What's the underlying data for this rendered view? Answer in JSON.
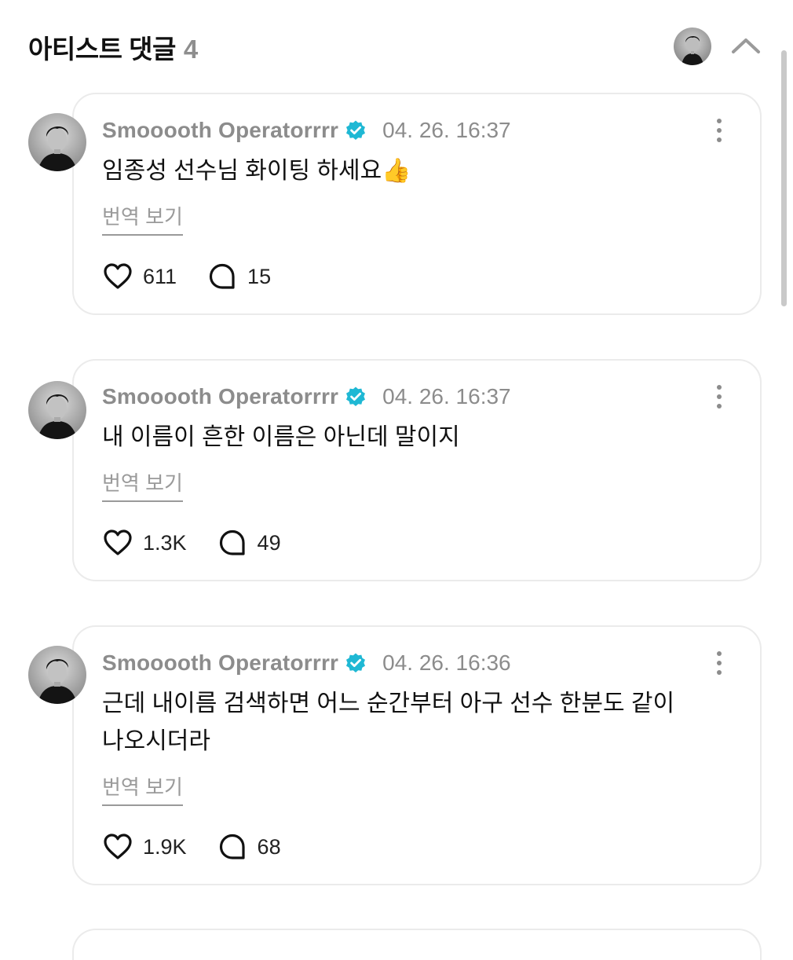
{
  "header": {
    "title": "아티스트 댓글",
    "count": "4"
  },
  "comments": [
    {
      "author": "Smooooth Operatorrrr",
      "time": "04. 26. 16:37",
      "text": "임종성 선수님 화이팅 하세요👍",
      "translate_label": "번역 보기",
      "likes": "611",
      "replies": "15"
    },
    {
      "author": "Smooooth Operatorrrr",
      "time": "04. 26. 16:37",
      "text": "내 이름이 흔한 이름은 아닌데 말이지",
      "translate_label": "번역 보기",
      "likes": "1.3K",
      "replies": "49"
    },
    {
      "author": "Smooooth Operatorrrr",
      "time": "04. 26. 16:36",
      "text": "근데 내이름 검색하면 어느 순간부터 아구 선수 한분도 같이 나오시더라",
      "translate_label": "번역 보기",
      "likes": "1.9K",
      "replies": "68"
    }
  ],
  "colors": {
    "verified_badge": "#1fb8d4",
    "muted_text": "#8c8c8c",
    "card_border": "#ebebeb"
  },
  "icons": {
    "collapse": "chevron-up-icon",
    "verified": "verified-badge-icon",
    "more": "more-vertical-icon",
    "like": "heart-icon",
    "reply": "speech-bubble-icon"
  }
}
